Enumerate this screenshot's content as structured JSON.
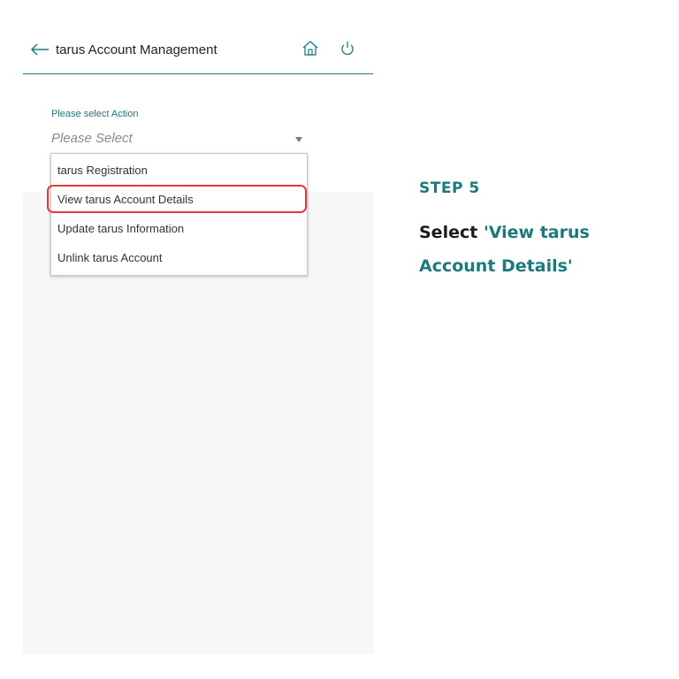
{
  "header": {
    "title": "tarus Account Management",
    "back_icon": "arrow-left-icon",
    "home_icon": "home-icon",
    "power_icon": "power-icon"
  },
  "form": {
    "label": "Please select Action",
    "select_value": "Please Select",
    "options": [
      "tarus Registration",
      "View tarus Account Details",
      "Update tarus Information",
      "Unlink tarus Account"
    ],
    "highlighted_option": "View tarus Account Details"
  },
  "instructions": {
    "step": "STEP 5",
    "text_prefix": "Select ",
    "text_accent": "'View tarus Account Details'"
  },
  "colors": {
    "accent": "#1a7a7c",
    "highlight": "#e53935",
    "background_grey": "#f7f7f7"
  }
}
